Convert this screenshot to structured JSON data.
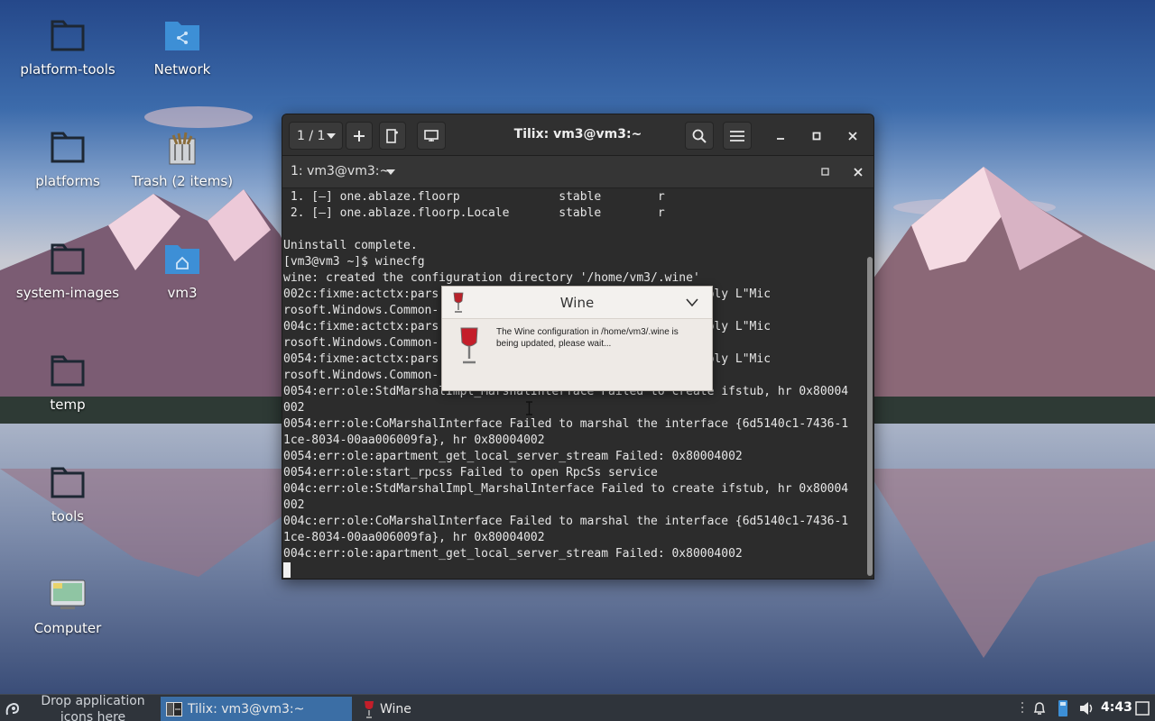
{
  "desktop": {
    "icons": [
      {
        "label": "platform-tools",
        "icon": "folder-icon"
      },
      {
        "label": "Network",
        "icon": "network-folder-icon"
      },
      {
        "label": "platforms",
        "icon": "folder-icon"
      },
      {
        "label": "Trash (2 items)",
        "icon": "trash-full-icon"
      },
      {
        "label": "system-images",
        "icon": "folder-icon"
      },
      {
        "label": "vm3",
        "icon": "home-folder-icon"
      },
      {
        "label": "temp",
        "icon": "folder-icon"
      },
      {
        "label": "tools",
        "icon": "folder-icon"
      },
      {
        "label": "Computer",
        "icon": "computer-icon"
      }
    ]
  },
  "terminal": {
    "window_title": "Tilix: vm3@vm3:~",
    "session_counter": "1 / 1",
    "session_title": "1: vm3@vm3:~",
    "lines": [
      " 1. [–] one.ablaze.floorp              stable        r",
      " 2. [–] one.ablaze.floorp.Locale       stable        r",
      "",
      "Uninstall complete.",
      "[vm3@vm3 ~]$ winecfg",
      "wine: created the configuration directory '/home/vm3/.wine'",
      "002c:fixme:actctx:pars                          endent assembly L\"Mic",
      "rosoft.Windows.Common-",
      "004c:fixme:actctx:pars                          endent assembly L\"Mic",
      "rosoft.Windows.Common-",
      "0054:fixme:actctx:pars                          endent assembly L\"Mic",
      "rosoft.Windows.Common-",
      "0054:err:ole:StdMarshalImpl_MarshalInterface Failed to create ifstub, hr 0x80004",
      "002",
      "0054:err:ole:CoMarshalInterface Failed to marshal the interface {6d5140c1-7436-1",
      "1ce-8034-00aa006009fa}, hr 0x80004002",
      "0054:err:ole:apartment_get_local_server_stream Failed: 0x80004002",
      "0054:err:ole:start_rpcss Failed to open RpcSs service",
      "004c:err:ole:StdMarshalImpl_MarshalInterface Failed to create ifstub, hr 0x80004",
      "002",
      "004c:err:ole:CoMarshalInterface Failed to marshal the interface {6d5140c1-7436-1",
      "1ce-8034-00aa006009fa}, hr 0x80004002",
      "004c:err:ole:apartment_get_local_server_stream Failed: 0x80004002"
    ]
  },
  "wine_dialog": {
    "title": "Wine",
    "message": "The Wine configuration in /home/vm3/.wine is being updated, please wait..."
  },
  "taskbar": {
    "drop_hint": "Drop application icons here",
    "tasks": [
      {
        "label": "Tilix: vm3@vm3:~",
        "active": true
      },
      {
        "label": "Wine",
        "active": false
      }
    ],
    "clock": "4:43"
  },
  "colors": {
    "terminal_bg": "#2c2c2c",
    "taskbar_bg": "#2f343b",
    "active_task": "#3b6ea5",
    "folder": "#2c3e50",
    "folder_blue": "#3d8fd6"
  }
}
